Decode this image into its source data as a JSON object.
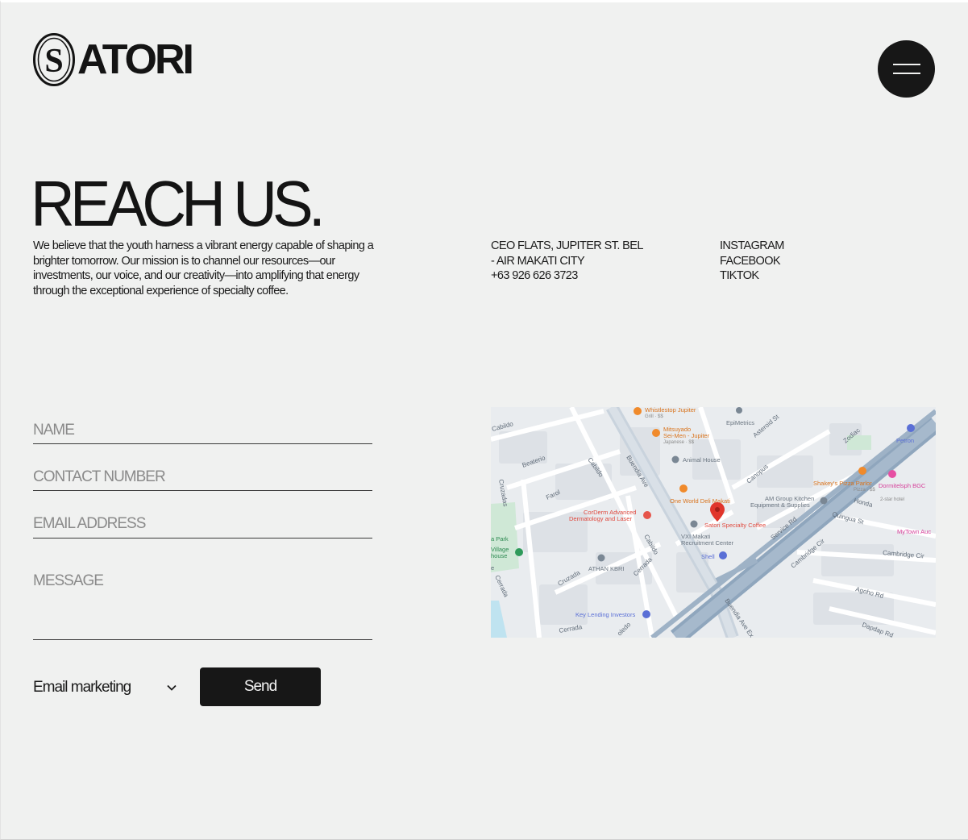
{
  "brand": {
    "logo_text": "ATORI",
    "logo_letter": "S"
  },
  "menu": {
    "label": "Menu"
  },
  "hero": {
    "title": "REACH US.",
    "intro": "We believe that the youth harness a vibrant energy capable of shaping a brighter tomorrow. Our mission is to channel our resources—our investments, our voice, and our creativity—into amplifying that energy through the exceptional experience of specialty coffee."
  },
  "contact": {
    "address_line1": "CEO FLATS, JUPITER ST. BEL",
    "address_line2": "- AIR MAKATI CITY",
    "phone": "+63 926 626 3723"
  },
  "socials": [
    "INSTAGRAM",
    "FACEBOOK",
    "TIKTOK"
  ],
  "form": {
    "name_placeholder": "NAME",
    "contact_placeholder": "CONTACT NUMBER",
    "email_placeholder": "EMAIL ADDRESS",
    "message_placeholder": "MESSAGE",
    "select_value": "Email marketing",
    "send_label": "Send"
  },
  "map": {
    "labels": {
      "whistlestop": "Whistlestop Jupiter",
      "grill": "Grill · $$",
      "epimetrics": "EpiMetrics",
      "mitsuyado": "Mitsuyado",
      "seimen": "Sei-Men - Jupiter",
      "japanese": "Japanese · $$",
      "animal_house": "Animal House",
      "one_world": "One World Deli Makati",
      "am_group1": "AM Group Kitchen",
      "am_group2": "Equipment & Supplies",
      "satori": "Satori Specialty Coffee",
      "corderm1": "CorDerm Advanced",
      "corderm2": "Dermatology and Laser",
      "vxi1": "VXI Makati",
      "vxi2": "Recruitment Center",
      "shell": "Shell",
      "athan": "ATHAN KBRI",
      "key_lending": "Key Lending Investors",
      "shakeys": "Shakey's Pizza Parlor",
      "pizza": "Pizza · $$",
      "dormitel": "Dormitelsph BGC",
      "hotel": "2-star hotel",
      "petron": "Petron",
      "mytown": "MyTown Auc",
      "park": "a Park",
      "village": "Village",
      "house": "house",
      "cabildo": "Cabildo",
      "beaterio": "Beaterio",
      "farol": "Farol",
      "cruzadas": "Cruzadas",
      "cruzada": "Cruzada",
      "cerrada": "Cerrada",
      "buendia": "Buendia Ave",
      "buendia_ext": "Buendia Ave Ex",
      "canopus": "Canopus",
      "asteroid": "Asteroid St",
      "zodiac": "Zodiac",
      "service_rd": "Service Rd",
      "honda": "Honda",
      "quingua": "Quingua St",
      "cambridge_cir": "Cambridge Cir",
      "cambridge": "Cambridge Cir",
      "agoho": "Agoho Rd",
      "dapdap": "Dapdap Rd",
      "toledo": "oledo",
      "e": "e"
    }
  }
}
